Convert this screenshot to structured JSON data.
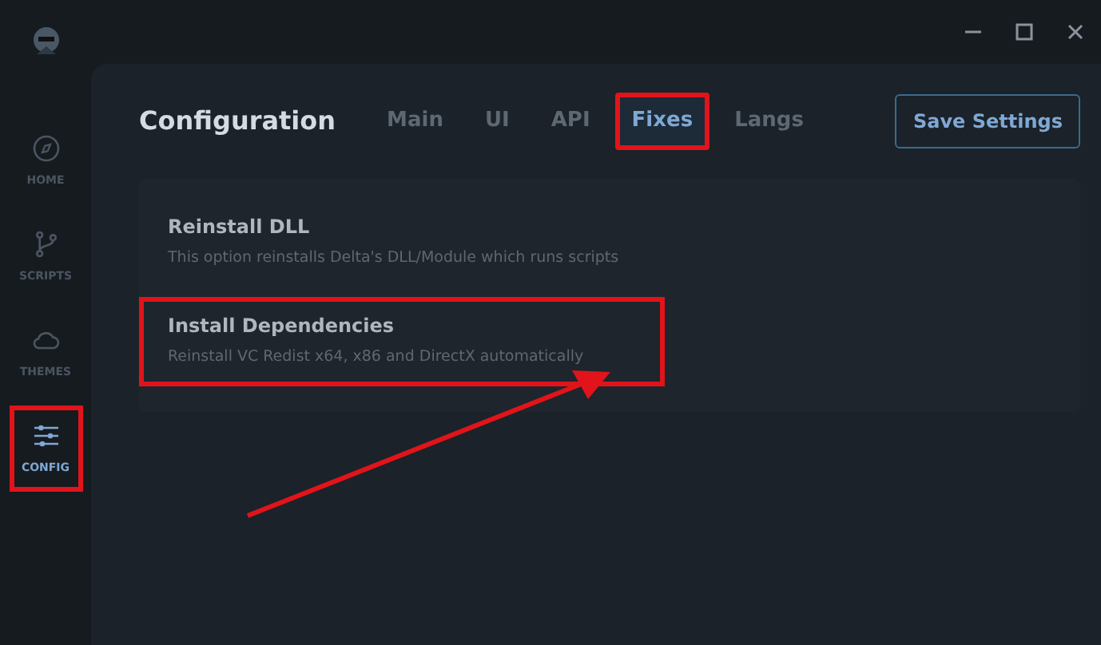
{
  "sidebar": {
    "items": [
      {
        "kind": "compass",
        "label": "HOME",
        "selected": false,
        "highlighted": false
      },
      {
        "kind": "branch",
        "label": "SCRIPTS",
        "selected": false,
        "highlighted": false
      },
      {
        "kind": "cloud",
        "label": "THEMES",
        "selected": false,
        "highlighted": false
      },
      {
        "kind": "sliders",
        "label": "CONFIG",
        "selected": true,
        "highlighted": true
      }
    ]
  },
  "header": {
    "title": "Configuration",
    "tabs": [
      {
        "label": "Main",
        "selected": false,
        "highlighted": false
      },
      {
        "label": "UI",
        "selected": false,
        "highlighted": false
      },
      {
        "label": "API",
        "selected": false,
        "highlighted": false
      },
      {
        "label": "Fixes",
        "selected": true,
        "highlighted": true
      },
      {
        "label": "Langs",
        "selected": false,
        "highlighted": false
      }
    ],
    "button": "Save Settings"
  },
  "options": [
    {
      "title": "Reinstall DLL",
      "description": "This option reinstalls Delta's DLL/Module which runs scripts",
      "highlighted": false
    },
    {
      "title": "Install Dependencies",
      "description": "Reinstall VC Redist x64, x86 and DirectX automatically",
      "highlighted": true
    }
  ],
  "annotation_arrow": true
}
